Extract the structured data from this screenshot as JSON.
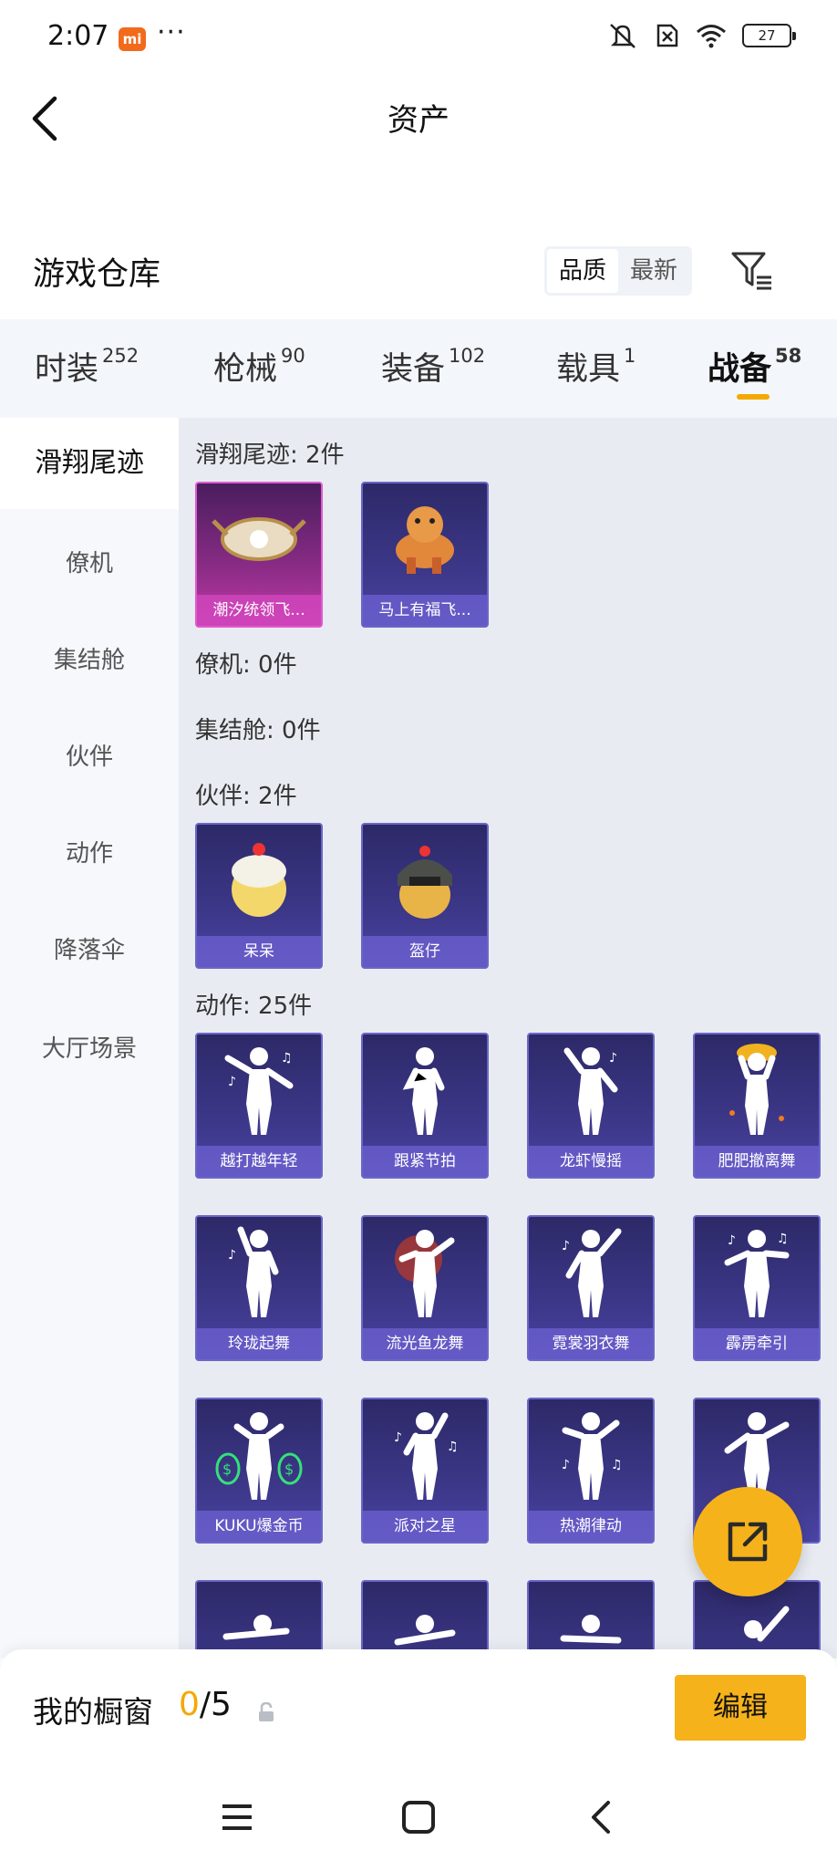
{
  "status": {
    "time": "2:07",
    "battery": "27",
    "brand_badge": "mi"
  },
  "header": {
    "title": "资产"
  },
  "section": {
    "title": "游戏仓库",
    "sort_quality": "品质",
    "sort_latest": "最新"
  },
  "tabs": [
    {
      "label": "时装",
      "count": "252"
    },
    {
      "label": "枪械",
      "count": "90"
    },
    {
      "label": "装备",
      "count": "102"
    },
    {
      "label": "载具",
      "count": "1"
    },
    {
      "label": "战备",
      "count": "58"
    }
  ],
  "sidebar": {
    "items": [
      "滑翔尾迹",
      "僚机",
      "集结舱",
      "伙伴",
      "动作",
      "降落伞",
      "大厅场景"
    ]
  },
  "groups": {
    "glide": {
      "title": "滑翔尾迹: 2件",
      "items": [
        "潮汐统领飞...",
        "马上有福飞..."
      ]
    },
    "wingman": {
      "title": "僚机: 0件"
    },
    "pod": {
      "title": "集结舱: 0件"
    },
    "partner": {
      "title": "伙伴: 2件",
      "items": [
        "呆呆",
        "盔仔"
      ]
    },
    "emote": {
      "title": "动作: 25件",
      "items": [
        "越打越年轻",
        "跟紧节拍",
        "龙虾慢摇",
        "肥肥撤离舞",
        "玲珑起舞",
        "流光鱼龙舞",
        "霓裳羽衣舞",
        "霹雳牵引",
        "KUKU爆金币",
        "派对之星",
        "热潮律动"
      ]
    }
  },
  "showcase": {
    "label": "我的橱窗",
    "current": "0",
    "total": "/5",
    "edit": "编辑"
  },
  "colors": {
    "accent": "#f6b21a",
    "tile_border": "#6b66c8",
    "tile_pink": "#c23aa7"
  },
  "icons": [
    "back-icon",
    "filter-icon",
    "share-icon",
    "lock-icon",
    "mute-icon",
    "sim-icon",
    "wifi-icon",
    "menu-icon",
    "home-icon",
    "nav-back-icon"
  ]
}
